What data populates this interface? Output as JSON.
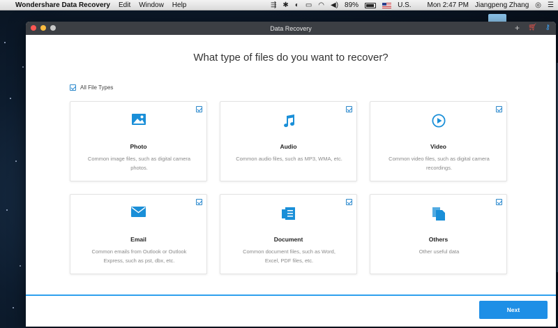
{
  "menubar": {
    "app_name": "Wondershare Data Recovery",
    "menus": [
      "Edit",
      "Window",
      "Help"
    ],
    "battery": "89%",
    "input_source": "U.S.",
    "clock": "Mon 2:47 PM",
    "user": "Jiangpeng Zhang"
  },
  "window": {
    "title": "Data Recovery"
  },
  "main": {
    "heading": "What type of files do you want to recover?",
    "all_file_types_label": "All File Types",
    "cards": [
      {
        "name": "Photo",
        "desc": "Common image files, such as digital camera photos.",
        "icon": "image-icon"
      },
      {
        "name": "Audio",
        "desc": "Common audio files, such as MP3, WMA, etc.",
        "icon": "music-note-icon"
      },
      {
        "name": "Video",
        "desc": "Common video files, such as digital camera recordings.",
        "icon": "play-circle-icon"
      },
      {
        "name": "Email",
        "desc": "Common emails from Outlook or Outlook Express, such as pst, dbx, etc.",
        "icon": "envelope-icon"
      },
      {
        "name": "Document",
        "desc": "Common document files, such as Word, Excel, PDF files, etc.",
        "icon": "document-icon"
      },
      {
        "name": "Others",
        "desc": "Other useful data",
        "icon": "files-icon"
      }
    ]
  },
  "footer": {
    "next_label": "Next"
  },
  "colors": {
    "accent": "#1e8fe6",
    "icon_blue": "#1a8fd8",
    "titlebar": "#3c3f44"
  }
}
